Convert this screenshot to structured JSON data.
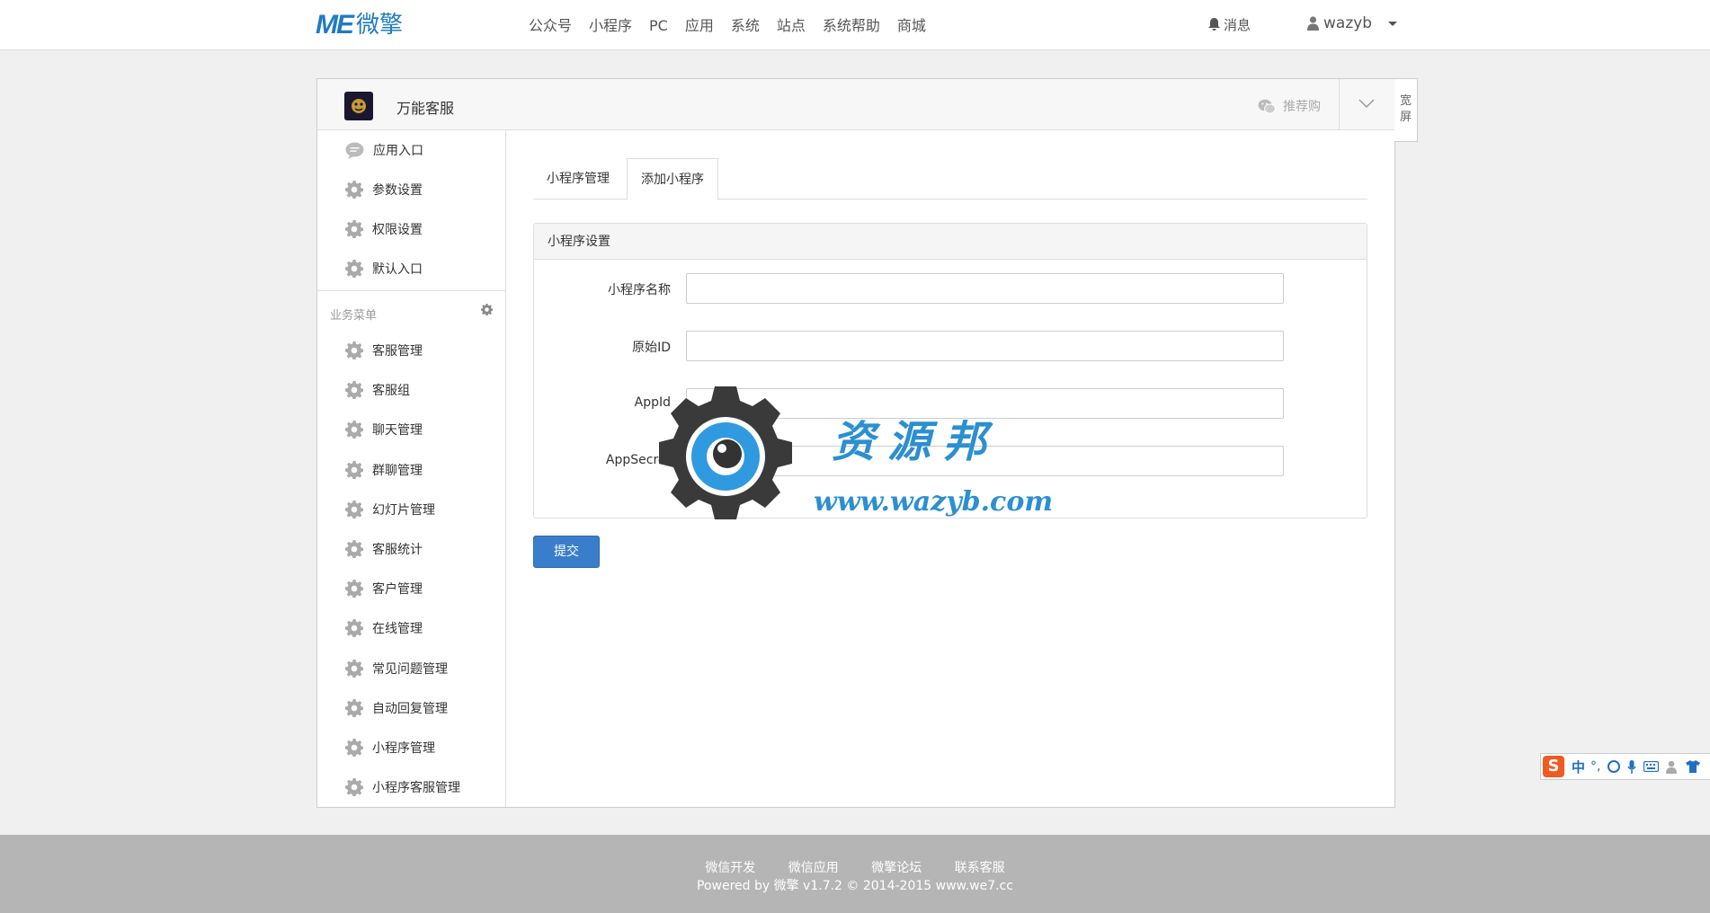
{
  "topbar": {
    "logo_mark": "ME",
    "logo_text": "微擎",
    "nav": [
      "公众号",
      "小程序",
      "PC",
      "应用",
      "系统",
      "站点",
      "系统帮助",
      "商城"
    ],
    "messages_label": "消息",
    "username": "wazyb"
  },
  "panel": {
    "app_name": "万能客服",
    "recommend_label": "推荐购",
    "wide_label": "宽屏"
  },
  "sidebar": {
    "top_items": [
      "应用入口",
      "参数设置",
      "权限设置",
      "默认入口"
    ],
    "section_title": "业务菜单",
    "menu_items": [
      "客服管理",
      "客服组",
      "聊天管理",
      "群聊管理",
      "幻灯片管理",
      "客服统计",
      "客户管理",
      "在线管理",
      "常见问题管理",
      "自动回复管理",
      "小程序管理",
      "小程序客服管理"
    ]
  },
  "tabs": [
    "小程序管理",
    "添加小程序"
  ],
  "active_tab": 1,
  "form": {
    "title": "小程序设置",
    "fields": [
      {
        "label": "小程序名称",
        "value": ""
      },
      {
        "label": "原始ID",
        "value": ""
      },
      {
        "label": "AppId",
        "value": ""
      },
      {
        "label": "AppSecret",
        "value": ""
      }
    ],
    "submit_label": "提交"
  },
  "watermark": {
    "text": "资源邦",
    "url": "www.wazyb.com"
  },
  "footer": {
    "links": [
      "微信开发",
      "微信应用",
      "微擎论坛",
      "联系客服"
    ],
    "copyright": "Powered by 微擎 v1.7.2 © 2014-2015 www.we7.cc"
  },
  "ime": {
    "logo": "S",
    "mode": "中"
  }
}
